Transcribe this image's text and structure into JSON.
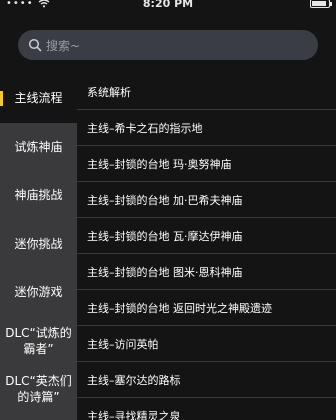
{
  "status_bar": {
    "carrier": "••••",
    "time": "8:20 PM"
  },
  "search": {
    "placeholder": "搜索~"
  },
  "sidebar": {
    "items": [
      {
        "label": "主线流程",
        "active": true
      },
      {
        "label": "试炼神庙"
      },
      {
        "label": "神庙挑战"
      },
      {
        "label": "迷你挑战"
      },
      {
        "label": "迷你游戏"
      },
      {
        "label": "DLC“试炼的霸者”"
      },
      {
        "label": "DLC“英杰们的诗篇”"
      }
    ]
  },
  "list": {
    "items": [
      "系统解析",
      "主线–希卡之石的指示地",
      "主线–封锁的台地 玛·奥努神庙",
      "主线–封锁的台地 加·巴希夫神庙",
      "主线–封锁的台地 瓦·摩达伊神庙",
      "主线–封锁的台地 图米·恩科神庙",
      "主线–封锁的台地 返回时光之神殿遗迹",
      "主线–访问英帕",
      "主线–塞尔达的路标",
      "主线–寻找精灵之泉"
    ]
  },
  "colors": {
    "background": "#141414",
    "sidebar": "#3a3a3c",
    "accent": "#f0c542",
    "search_bg": "#3a3d44"
  }
}
